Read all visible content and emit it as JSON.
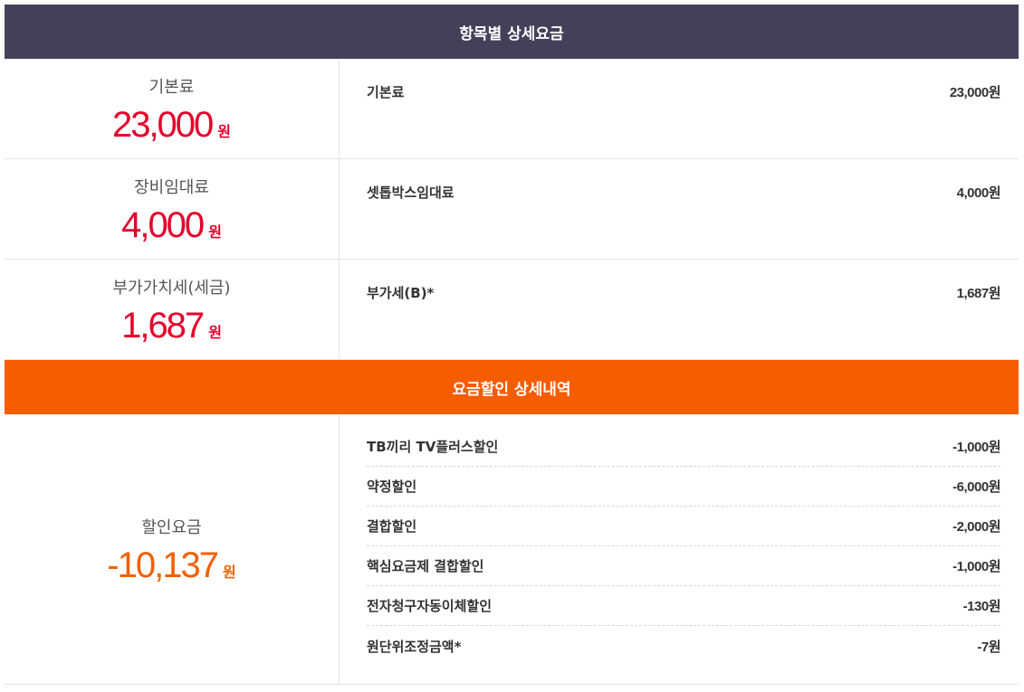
{
  "charges_section": {
    "title": "항목별 상세요금",
    "rows": [
      {
        "label": "기본료",
        "amount": "23,000",
        "unit": "원",
        "item_name": "기본료",
        "item_value": "23,000원"
      },
      {
        "label": "장비임대료",
        "amount": "4,000",
        "unit": "원",
        "item_name": "셋톱박스임대료",
        "item_value": "4,000원"
      },
      {
        "label": "부가가치세(세금)",
        "amount": "1,687",
        "unit": "원",
        "item_name": "부가세(B)*",
        "item_value": "1,687원"
      }
    ]
  },
  "discount_section": {
    "title": "요금할인 상세내역",
    "label": "할인요금",
    "amount": "-10,137",
    "unit": "원",
    "items": [
      {
        "name": "TB끼리 TV플러스할인",
        "value": "-1,000원"
      },
      {
        "name": "약정할인",
        "value": "-6,000원"
      },
      {
        "name": "결합할인",
        "value": "-2,000원"
      },
      {
        "name": "핵심요금제 결합할인",
        "value": "-1,000원"
      },
      {
        "name": "전자청구자동이체할인",
        "value": "-130원"
      },
      {
        "name": "원단위조정금액*",
        "value": "-7원"
      }
    ]
  },
  "colors": {
    "header_dark": "#45405a",
    "header_orange": "#f65c00",
    "amount_red": "#e4002b",
    "amount_orange": "#f06000"
  }
}
